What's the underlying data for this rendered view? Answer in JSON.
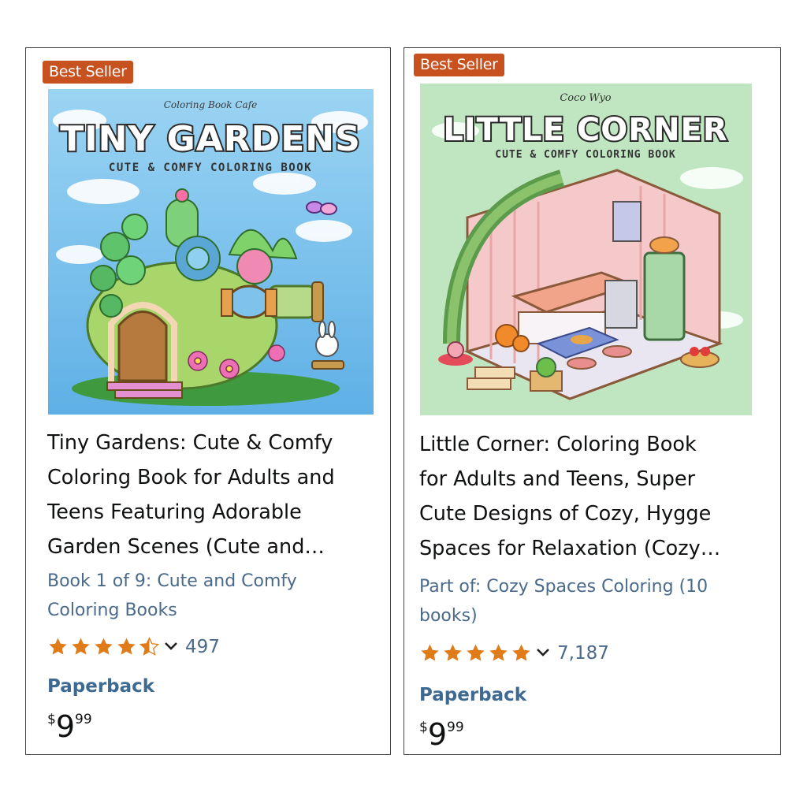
{
  "products": [
    {
      "badge": "Best Seller",
      "cover": {
        "publisher": "Coloring Book Cafe",
        "heading": "TINY GARDENS",
        "subheading": "CUTE & COMFY COLORING BOOK",
        "bg_color": "#7cc6ee"
      },
      "title_lines": [
        "Tiny Gardens: Cute & Comfy",
        "Coloring Book for Adults and",
        "Teens Featuring Adorable",
        "Garden Scenes (Cute and…"
      ],
      "series_lines": [
        "Book 1 of 9: Cute and Comfy",
        "Coloring Books"
      ],
      "rating": 4.5,
      "rating_count": "497",
      "format": "Paperback",
      "price": {
        "symbol": "$",
        "whole": "9",
        "fraction": "99"
      }
    },
    {
      "badge": "Best Seller",
      "cover": {
        "publisher": "Coco Wyo",
        "heading": "LITTLE CORNER",
        "subheading": "CUTE & COMFY COLORING BOOK",
        "bg_color": "#bfe6c0"
      },
      "title_lines": [
        "Little Corner: Coloring Book",
        "for Adults and Teens, Super",
        "Cute Designs of Cozy, Hygge",
        "Spaces for Relaxation (Cozy…"
      ],
      "series_lines": [
        "Part of: Cozy Spaces Coloring (10",
        "books)"
      ],
      "rating": 5,
      "rating_count": "7,187",
      "format": "Paperback",
      "price": {
        "symbol": "$",
        "whole": "9",
        "fraction": "99"
      }
    }
  ],
  "colors": {
    "badge": "#c7511f",
    "link": "#4a6a8c",
    "star": "#e07b1a",
    "format": "#3e6a92"
  }
}
